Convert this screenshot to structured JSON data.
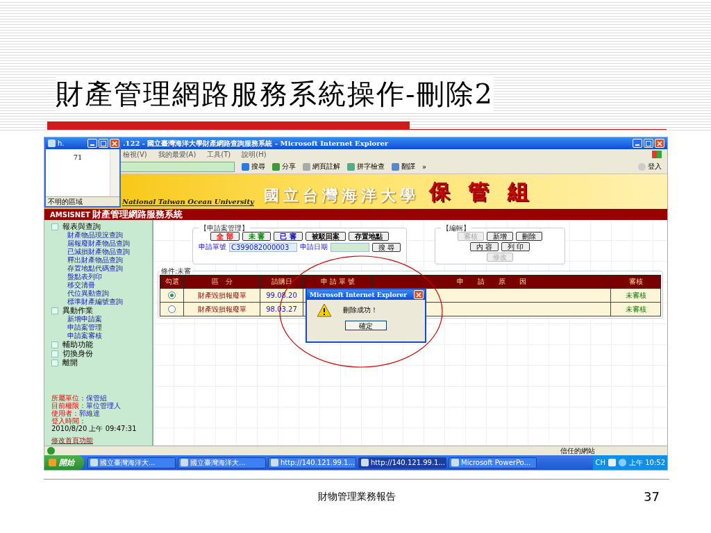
{
  "slide": {
    "title": "財產管理網路服務系統操作-刪除2",
    "footer": "財物管理業務報告",
    "page_number": "37"
  },
  "small_window": {
    "title": "h.",
    "value": "71",
    "status": "不明的區域"
  },
  "ie_window": {
    "title": ".122 - 國立臺灣海洋大學財產網路查詢服務系統 - Microsoft Internet Explorer",
    "menu": [
      "檢視(V)",
      "我的最愛(A)",
      "工具(T)",
      "說明(H)"
    ],
    "toolbar": [
      "搜尋",
      "分享",
      "網頁註解",
      "拼字檢查",
      "翻譯",
      "»",
      "登入"
    ],
    "status_bar": "信任的網站"
  },
  "banner": {
    "university": "國立台灣海洋大學",
    "english": "National Taiwan Ocean University",
    "unit": "保 管 組"
  },
  "app_bar": {
    "code": "AMSISNET",
    "title": "財產管理網路服務系統"
  },
  "sidebar": {
    "groups": [
      {
        "label": "報表與查詢",
        "children": [
          "財產物品現況查詢",
          "屆報廢財產物品查詢",
          "已減損財產物品查詢",
          "釋出財產物品查詢",
          "存置地點代碼查詢",
          "盤點表列印",
          "移交清冊",
          "代位異動查詢",
          "標準財產編號查詢"
        ]
      },
      {
        "label": "異動作業",
        "children": [
          "新增申請案",
          "申請案管理",
          "申請案審核"
        ]
      },
      {
        "label": "輔助功能"
      },
      {
        "label": "切換身份"
      },
      {
        "label": "離開"
      }
    ],
    "info": [
      {
        "label": "所屬單位：",
        "value": "保管組"
      },
      {
        "label": "目前權限：",
        "value": "單位管理人"
      },
      {
        "label": "使用者：",
        "value": "郭維達"
      },
      {
        "label": "登入時間："
      }
    ],
    "login_time": "2010/8/20 上午 09:47:31",
    "link": "修改首頁功能"
  },
  "apply_panel": {
    "legend": "【申請案管理】",
    "buttons": [
      {
        "label": "全 部",
        "color": "#ee0000"
      },
      {
        "label": "未 審",
        "color": "#008800"
      },
      {
        "label": "已 審",
        "color": "#0000cc"
      },
      {
        "label": "被駁回案",
        "color": "#000000"
      },
      {
        "label": "存置地點",
        "color": "#000000"
      }
    ],
    "number_label": "申請單號",
    "number_value": "C399082000003",
    "date_label": "申請日期",
    "search": "搜 尋"
  },
  "edit_panel": {
    "legend": "【編輯】",
    "rows": [
      [
        {
          "label": "審核",
          "disabled": true
        },
        {
          "label": "新增",
          "disabled": false
        },
        {
          "label": "刪除",
          "disabled": false
        }
      ],
      [
        {
          "label": "內 容",
          "disabled": false
        },
        {
          "label": "列 印",
          "disabled": false
        }
      ],
      [
        {
          "label": "修改",
          "disabled": true
        }
      ]
    ]
  },
  "table": {
    "condition": "條件:未審",
    "columns": [
      "勾選",
      "區　分",
      "請購日",
      "申 請 單 號",
      "申　　請　　原　　因",
      "審核"
    ],
    "rows": [
      {
        "selected": true,
        "category": "財產毀損報廢單",
        "date": "99.08.20",
        "review": "未審核"
      },
      {
        "selected": false,
        "category": "財產毀損報廢單",
        "date": "98.03.27",
        "review": "未審核"
      }
    ]
  },
  "dialog": {
    "title": "Microsoft Internet Explorer",
    "message": "刪除成功！",
    "button": "確定"
  },
  "taskbar": {
    "start": "開始",
    "tasks": [
      {
        "label": "國立臺灣海洋大...",
        "selected": false
      },
      {
        "label": "國立臺灣海洋大...",
        "selected": false
      },
      {
        "label": "http://140.121.99.1...",
        "selected": false
      },
      {
        "label": "http://140.121.99.1...",
        "selected": true
      },
      {
        "label": "Microsoft PowerPo...",
        "selected": false
      }
    ],
    "language": "CH",
    "clock": "上午 10:52"
  }
}
